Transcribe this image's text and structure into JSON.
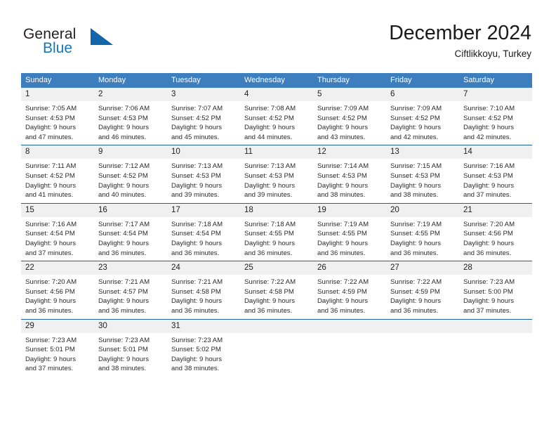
{
  "brand": {
    "word1": "General",
    "word2": "Blue",
    "triangle_color": "#1165a8"
  },
  "header": {
    "title": "December 2024",
    "subtitle": "Ciftlikkoyu, Turkey"
  },
  "theme": {
    "header_row_bg": "#3d7ebf",
    "week_divider": "#1f5fa4",
    "day_number_bg": "#f0f0f0",
    "text": "#2a2a2a"
  },
  "weekdays": [
    "Sunday",
    "Monday",
    "Tuesday",
    "Wednesday",
    "Thursday",
    "Friday",
    "Saturday"
  ],
  "weeks": [
    [
      {
        "day": "1",
        "sunrise": "Sunrise: 7:05 AM",
        "sunset": "Sunset: 4:53 PM",
        "daylight1": "Daylight: 9 hours",
        "daylight2": "and 47 minutes."
      },
      {
        "day": "2",
        "sunrise": "Sunrise: 7:06 AM",
        "sunset": "Sunset: 4:53 PM",
        "daylight1": "Daylight: 9 hours",
        "daylight2": "and 46 minutes."
      },
      {
        "day": "3",
        "sunrise": "Sunrise: 7:07 AM",
        "sunset": "Sunset: 4:52 PM",
        "daylight1": "Daylight: 9 hours",
        "daylight2": "and 45 minutes."
      },
      {
        "day": "4",
        "sunrise": "Sunrise: 7:08 AM",
        "sunset": "Sunset: 4:52 PM",
        "daylight1": "Daylight: 9 hours",
        "daylight2": "and 44 minutes."
      },
      {
        "day": "5",
        "sunrise": "Sunrise: 7:09 AM",
        "sunset": "Sunset: 4:52 PM",
        "daylight1": "Daylight: 9 hours",
        "daylight2": "and 43 minutes."
      },
      {
        "day": "6",
        "sunrise": "Sunrise: 7:09 AM",
        "sunset": "Sunset: 4:52 PM",
        "daylight1": "Daylight: 9 hours",
        "daylight2": "and 42 minutes."
      },
      {
        "day": "7",
        "sunrise": "Sunrise: 7:10 AM",
        "sunset": "Sunset: 4:52 PM",
        "daylight1": "Daylight: 9 hours",
        "daylight2": "and 42 minutes."
      }
    ],
    [
      {
        "day": "8",
        "sunrise": "Sunrise: 7:11 AM",
        "sunset": "Sunset: 4:52 PM",
        "daylight1": "Daylight: 9 hours",
        "daylight2": "and 41 minutes."
      },
      {
        "day": "9",
        "sunrise": "Sunrise: 7:12 AM",
        "sunset": "Sunset: 4:52 PM",
        "daylight1": "Daylight: 9 hours",
        "daylight2": "and 40 minutes."
      },
      {
        "day": "10",
        "sunrise": "Sunrise: 7:13 AM",
        "sunset": "Sunset: 4:53 PM",
        "daylight1": "Daylight: 9 hours",
        "daylight2": "and 39 minutes."
      },
      {
        "day": "11",
        "sunrise": "Sunrise: 7:13 AM",
        "sunset": "Sunset: 4:53 PM",
        "daylight1": "Daylight: 9 hours",
        "daylight2": "and 39 minutes."
      },
      {
        "day": "12",
        "sunrise": "Sunrise: 7:14 AM",
        "sunset": "Sunset: 4:53 PM",
        "daylight1": "Daylight: 9 hours",
        "daylight2": "and 38 minutes."
      },
      {
        "day": "13",
        "sunrise": "Sunrise: 7:15 AM",
        "sunset": "Sunset: 4:53 PM",
        "daylight1": "Daylight: 9 hours",
        "daylight2": "and 38 minutes."
      },
      {
        "day": "14",
        "sunrise": "Sunrise: 7:16 AM",
        "sunset": "Sunset: 4:53 PM",
        "daylight1": "Daylight: 9 hours",
        "daylight2": "and 37 minutes."
      }
    ],
    [
      {
        "day": "15",
        "sunrise": "Sunrise: 7:16 AM",
        "sunset": "Sunset: 4:54 PM",
        "daylight1": "Daylight: 9 hours",
        "daylight2": "and 37 minutes."
      },
      {
        "day": "16",
        "sunrise": "Sunrise: 7:17 AM",
        "sunset": "Sunset: 4:54 PM",
        "daylight1": "Daylight: 9 hours",
        "daylight2": "and 36 minutes."
      },
      {
        "day": "17",
        "sunrise": "Sunrise: 7:18 AM",
        "sunset": "Sunset: 4:54 PM",
        "daylight1": "Daylight: 9 hours",
        "daylight2": "and 36 minutes."
      },
      {
        "day": "18",
        "sunrise": "Sunrise: 7:18 AM",
        "sunset": "Sunset: 4:55 PM",
        "daylight1": "Daylight: 9 hours",
        "daylight2": "and 36 minutes."
      },
      {
        "day": "19",
        "sunrise": "Sunrise: 7:19 AM",
        "sunset": "Sunset: 4:55 PM",
        "daylight1": "Daylight: 9 hours",
        "daylight2": "and 36 minutes."
      },
      {
        "day": "20",
        "sunrise": "Sunrise: 7:19 AM",
        "sunset": "Sunset: 4:55 PM",
        "daylight1": "Daylight: 9 hours",
        "daylight2": "and 36 minutes."
      },
      {
        "day": "21",
        "sunrise": "Sunrise: 7:20 AM",
        "sunset": "Sunset: 4:56 PM",
        "daylight1": "Daylight: 9 hours",
        "daylight2": "and 36 minutes."
      }
    ],
    [
      {
        "day": "22",
        "sunrise": "Sunrise: 7:20 AM",
        "sunset": "Sunset: 4:56 PM",
        "daylight1": "Daylight: 9 hours",
        "daylight2": "and 36 minutes."
      },
      {
        "day": "23",
        "sunrise": "Sunrise: 7:21 AM",
        "sunset": "Sunset: 4:57 PM",
        "daylight1": "Daylight: 9 hours",
        "daylight2": "and 36 minutes."
      },
      {
        "day": "24",
        "sunrise": "Sunrise: 7:21 AM",
        "sunset": "Sunset: 4:58 PM",
        "daylight1": "Daylight: 9 hours",
        "daylight2": "and 36 minutes."
      },
      {
        "day": "25",
        "sunrise": "Sunrise: 7:22 AM",
        "sunset": "Sunset: 4:58 PM",
        "daylight1": "Daylight: 9 hours",
        "daylight2": "and 36 minutes."
      },
      {
        "day": "26",
        "sunrise": "Sunrise: 7:22 AM",
        "sunset": "Sunset: 4:59 PM",
        "daylight1": "Daylight: 9 hours",
        "daylight2": "and 36 minutes."
      },
      {
        "day": "27",
        "sunrise": "Sunrise: 7:22 AM",
        "sunset": "Sunset: 4:59 PM",
        "daylight1": "Daylight: 9 hours",
        "daylight2": "and 36 minutes."
      },
      {
        "day": "28",
        "sunrise": "Sunrise: 7:23 AM",
        "sunset": "Sunset: 5:00 PM",
        "daylight1": "Daylight: 9 hours",
        "daylight2": "and 37 minutes."
      }
    ],
    [
      {
        "day": "29",
        "sunrise": "Sunrise: 7:23 AM",
        "sunset": "Sunset: 5:01 PM",
        "daylight1": "Daylight: 9 hours",
        "daylight2": "and 37 minutes."
      },
      {
        "day": "30",
        "sunrise": "Sunrise: 7:23 AM",
        "sunset": "Sunset: 5:01 PM",
        "daylight1": "Daylight: 9 hours",
        "daylight2": "and 38 minutes."
      },
      {
        "day": "31",
        "sunrise": "Sunrise: 7:23 AM",
        "sunset": "Sunset: 5:02 PM",
        "daylight1": "Daylight: 9 hours",
        "daylight2": "and 38 minutes."
      },
      {
        "day": "",
        "sunrise": "",
        "sunset": "",
        "daylight1": "",
        "daylight2": ""
      },
      {
        "day": "",
        "sunrise": "",
        "sunset": "",
        "daylight1": "",
        "daylight2": ""
      },
      {
        "day": "",
        "sunrise": "",
        "sunset": "",
        "daylight1": "",
        "daylight2": ""
      },
      {
        "day": "",
        "sunrise": "",
        "sunset": "",
        "daylight1": "",
        "daylight2": ""
      }
    ]
  ]
}
